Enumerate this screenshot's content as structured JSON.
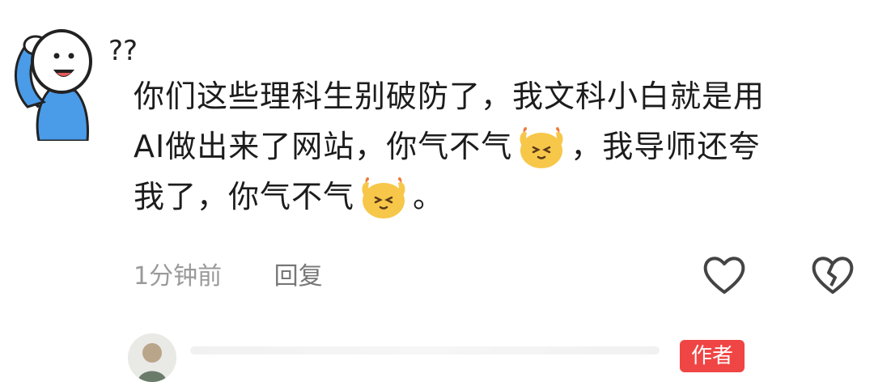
{
  "comment": {
    "avatar_annotation": "??",
    "text_lines": [
      "你们这些理科生别破防了，我文科小白就是用",
      "AI做出来了网站，你气不气",
      "，我导师还夸",
      "我了，你气不气",
      "。"
    ],
    "emoji_icon": "angry-face-emoji-icon",
    "timestamp": "1分钟前",
    "reply_label": "回复"
  },
  "reply": {
    "author_badge": "作者"
  },
  "colors": {
    "badge": "#f04545",
    "meta_text": "#9a9a9a",
    "avatar_shirt": "#4a9be8",
    "emoji_face": "#f7c74a"
  }
}
